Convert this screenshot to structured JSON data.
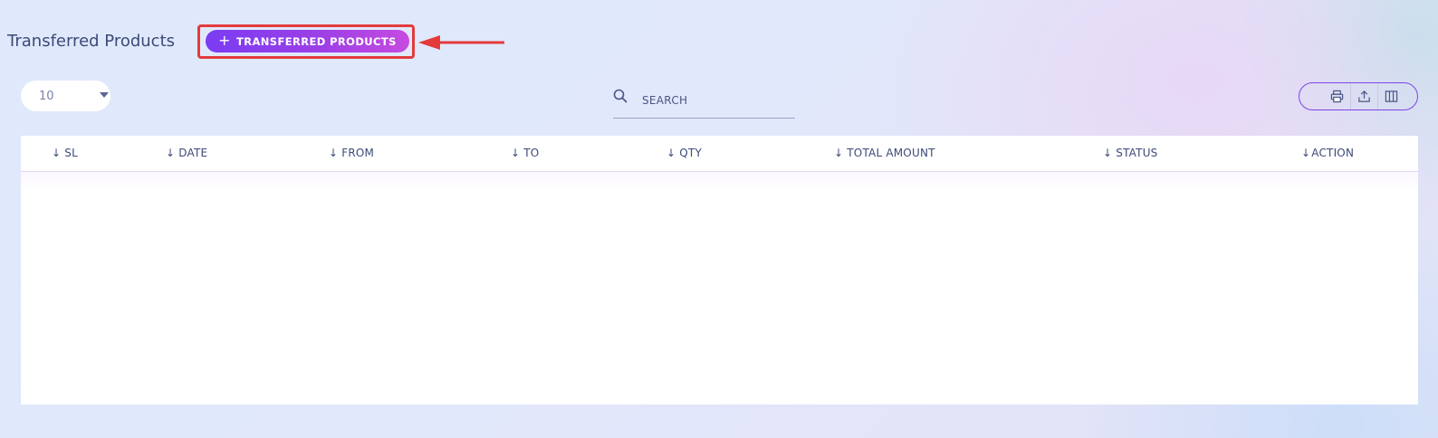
{
  "header": {
    "title": "Transferred Products",
    "add_button_label": "TRANSFERRED PRODUCTS",
    "add_button_plus": "+"
  },
  "controls": {
    "page_size": "10",
    "search_placeholder": "SEARCH"
  },
  "toolbar": {
    "icons": [
      "print-icon",
      "export-icon",
      "columns-icon"
    ]
  },
  "table": {
    "sort_glyph": "↓",
    "columns": [
      "SL",
      "DATE",
      "FROM",
      "TO",
      "QTY",
      "TOTAL AMOUNT",
      "STATUS",
      "ACTION"
    ],
    "rows": []
  },
  "colors": {
    "accent": "#7a3cf3",
    "annotation": "#e33b3b",
    "text": "#3d4a78"
  }
}
